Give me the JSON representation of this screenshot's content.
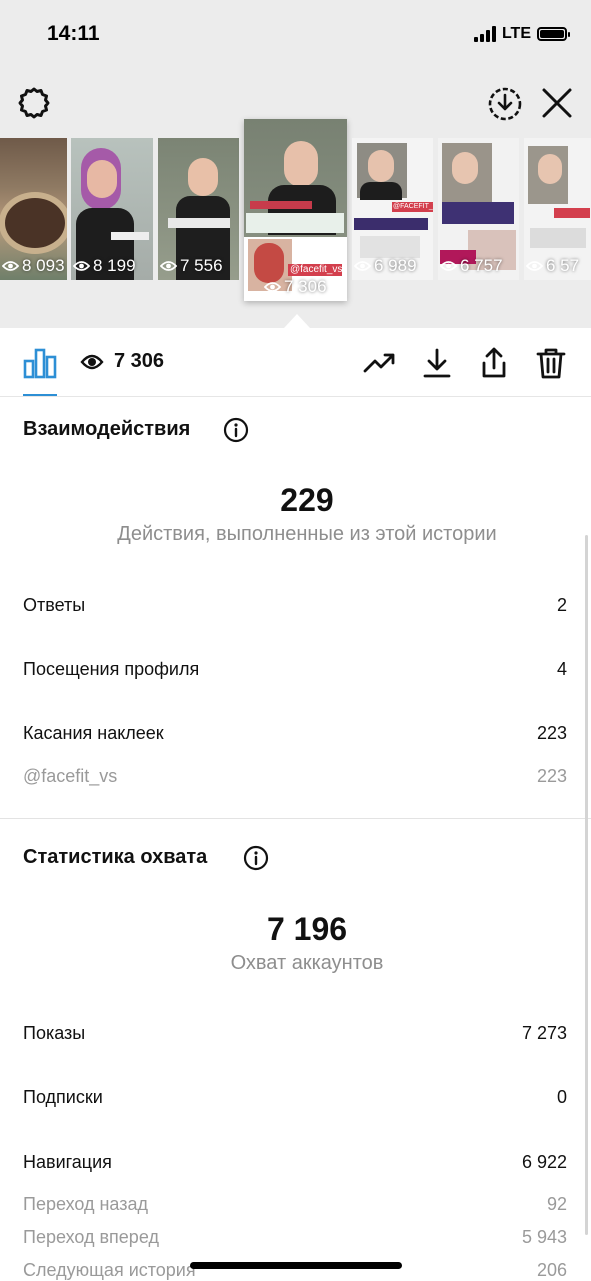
{
  "status_bar": {
    "time": "14:11",
    "network": "LTE"
  },
  "top_bar": {
    "icons": [
      "gear-icon",
      "download-story-icon",
      "close-icon"
    ]
  },
  "thumbnails": [
    {
      "views": "8 093"
    },
    {
      "views": "8 199"
    },
    {
      "views": "7 556"
    },
    {
      "views": "7 306",
      "selected": true,
      "sticker": "@facefit_vs"
    },
    {
      "views": "6 989",
      "sticker": "@FACEFIT_VS"
    },
    {
      "views": "6 757"
    },
    {
      "views": "6 57"
    }
  ],
  "toolbar": {
    "views": "7 306",
    "icons": [
      "chart-icon",
      "eye-icon",
      "trend-icon",
      "download-icon",
      "share-icon",
      "trash-icon"
    ],
    "accent_color": "#2d8fd5"
  },
  "interactions": {
    "title": "Взаимодействия",
    "total": "229",
    "caption": "Действия, выполненные из этой истории",
    "rows": [
      {
        "label": "Ответы",
        "value": "2"
      },
      {
        "label": "Посещения профиля",
        "value": "4"
      },
      {
        "label": "Касания наклеек",
        "value": "223"
      },
      {
        "label": "@facefit_vs",
        "value": "223"
      }
    ]
  },
  "reach": {
    "title": "Статистика охвата",
    "total": "7 196",
    "caption": "Охват аккаунтов",
    "rows": [
      {
        "label": "Показы",
        "value": "7 273"
      },
      {
        "label": "Подписки",
        "value": "0"
      },
      {
        "label": "Навигация",
        "value": "6 922"
      },
      {
        "label": "Переход назад",
        "value": "92"
      },
      {
        "label": "Переход вперед",
        "value": "5 943"
      },
      {
        "label": "Следующая история",
        "value": "206"
      }
    ]
  }
}
